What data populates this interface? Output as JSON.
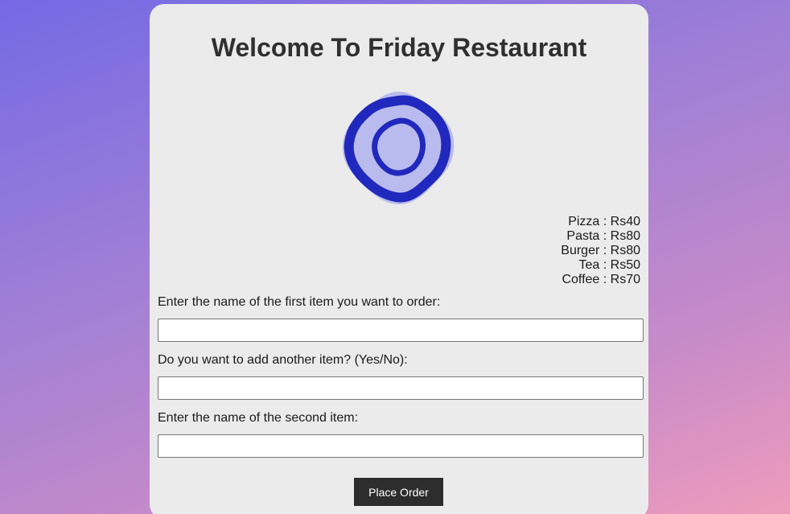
{
  "header": {
    "title": "Welcome To Friday Restaurant"
  },
  "logo": {
    "icon": "restaurant-logo-icon",
    "colors": {
      "primary": "#2028bd",
      "secondary": "#b9bbee"
    }
  },
  "menu": {
    "items": [
      {
        "text": "Pizza : Rs40"
      },
      {
        "text": "Pasta : Rs80"
      },
      {
        "text": "Burger : Rs80"
      },
      {
        "text": "Tea : Rs50"
      },
      {
        "text": "Coffee : Rs70"
      }
    ]
  },
  "form": {
    "first_item": {
      "label": "Enter the name of the first item you want to order:",
      "value": ""
    },
    "add_another": {
      "label": "Do you want to add another item? (Yes/No):",
      "value": ""
    },
    "second_item": {
      "label": "Enter the name of the second item:",
      "value": ""
    },
    "submit_label": "Place Order"
  }
}
